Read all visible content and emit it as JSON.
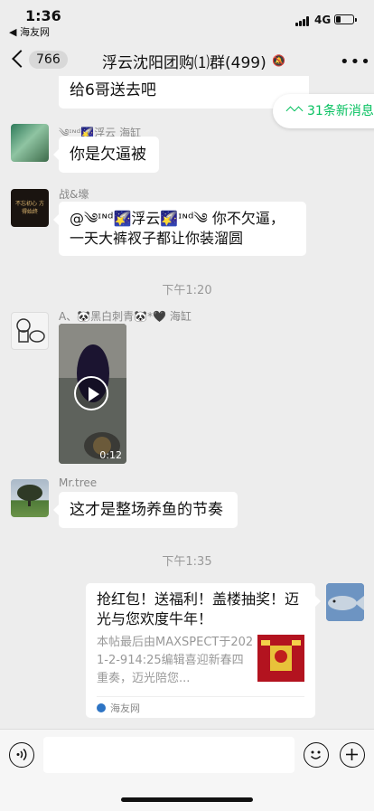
{
  "status_bar": {
    "time": "1:36",
    "back_app": "◀ 海友网",
    "network": "4G",
    "battery_fraction": 0.3
  },
  "nav": {
    "badge": "766",
    "title": "浮云沈阳团购⑴群(499)",
    "more": "•••"
  },
  "new_messages": "31条新消息",
  "messages": {
    "m0": {
      "text": "给6哥送去吧"
    },
    "m1": {
      "sender": "༄ᶦᶰᵈ🌠浮云 海缸",
      "text": "你是欠逼被"
    },
    "m2": {
      "sender": "战&壕",
      "avatar_text": "不忘初心 方得始终",
      "line1": "@༄ᶦᶰᵈ🌠浮云🌠ᶦᶰᵈ༄ 你不欠逼，",
      "line2": "一天大裤衩子都让你装溜圆"
    },
    "ts1": "下午1:20",
    "m3": {
      "sender": "A、🐼黑白刺青🐼*🖤 海缸",
      "duration": "0:12"
    },
    "m4": {
      "sender": "Mr.tree",
      "text": "这才是整场养鱼的节奏"
    },
    "ts2": "下午1:35",
    "card": {
      "title": "抢红包！送福利！盖楼抽奖！迈光与您欢度牛年！",
      "desc": "本帖最后由MAXSPECT于2021-2-914:25编辑喜迎新春四重奏，迈光陪您...",
      "source": "海友网"
    }
  },
  "icons": {
    "voice": "voice-icon",
    "emoji": "emoji-icon",
    "add": "add-icon"
  }
}
